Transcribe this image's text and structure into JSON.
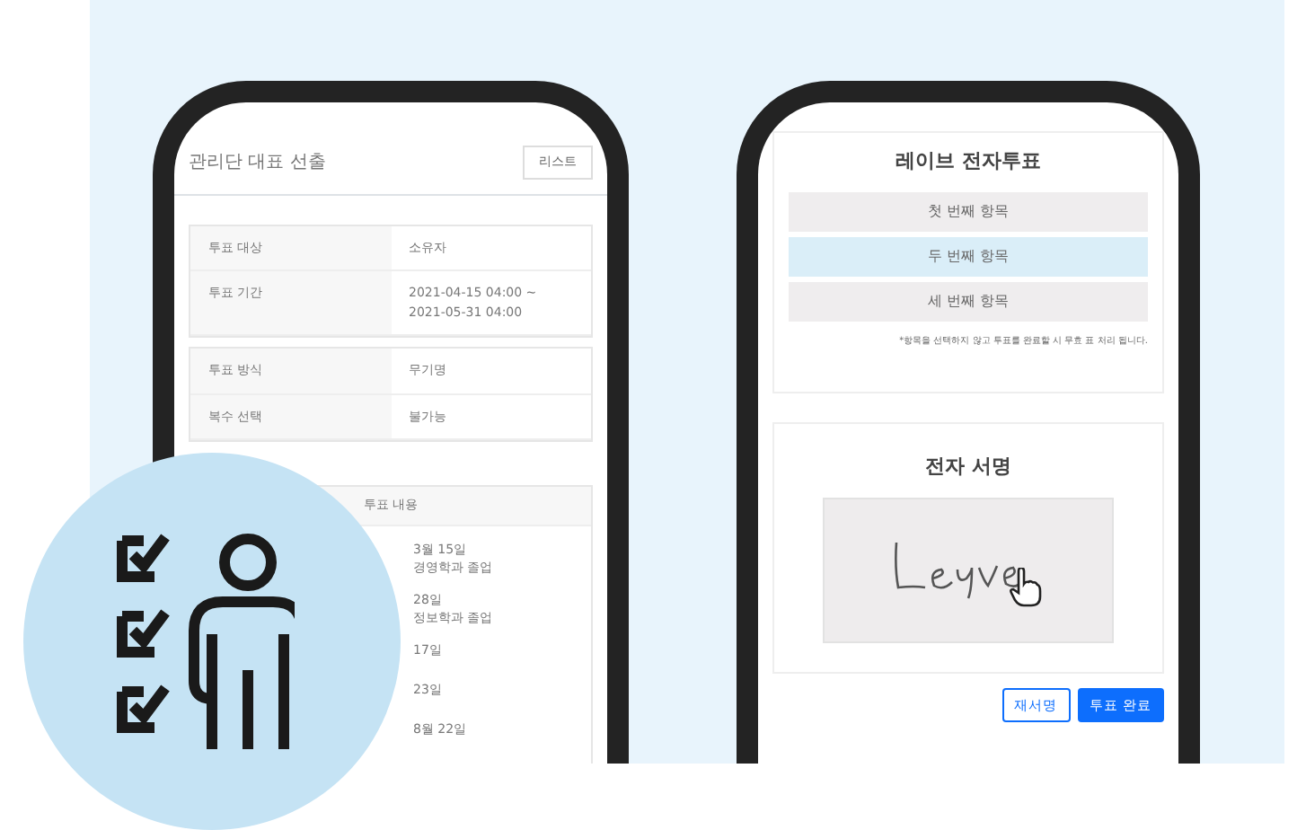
{
  "admin_phone": {
    "title": "관리단 대표 선출",
    "list_button": "리스트",
    "info_groups": [
      [
        {
          "label": "투표 대상",
          "value": "소유자"
        },
        {
          "label": "투표 기간",
          "value": "2021-04-15 04:00 ~ 2021-05-31 04:00"
        }
      ],
      [
        {
          "label": "투표 방식",
          "value": "무기명"
        },
        {
          "label": "복수 선택",
          "value": "불가능"
        }
      ]
    ],
    "content_header": "투표 내용",
    "content_lines": [
      "3월 15일",
      "경영학과 졸업",
      "28일",
      "정보학과 졸업",
      "17일",
      "23일",
      "8월 22일"
    ]
  },
  "vote_phone": {
    "title": "레이브 전자투표",
    "options": [
      {
        "label": "첫 번째 항목",
        "selected": false
      },
      {
        "label": "두 번째 항목",
        "selected": true
      },
      {
        "label": "세 번째 항목",
        "selected": false
      }
    ],
    "note": "*항목을 선택하지 않고 투표를 완료할 시 무효 표 처리 됩니다.",
    "signature_title": "전자 서명",
    "buttons": [
      {
        "label": "재서명",
        "kind": "outline"
      },
      {
        "label": "투표 완료",
        "kind": "primary"
      }
    ]
  }
}
